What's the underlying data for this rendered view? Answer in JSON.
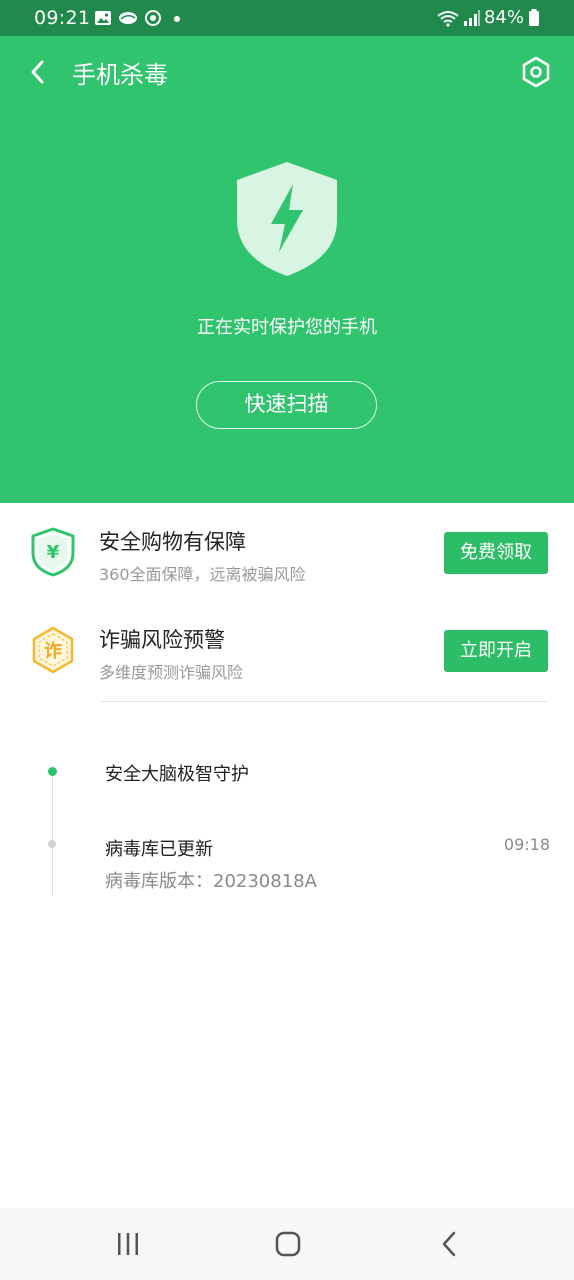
{
  "status_bar": {
    "time": "09:21",
    "battery": "84%"
  },
  "header": {
    "title": "手机杀毒",
    "back_icon": "back-arrow-icon",
    "settings_icon": "settings-hexagon-icon"
  },
  "hero": {
    "status": "正在实时保护您的手机",
    "scan_button": "快速扫描",
    "shield_icon": "lightning-shield-icon"
  },
  "features": [
    {
      "title": "安全购物有保障",
      "subtitle": "360全面保障，远离被骗风险",
      "button": "免费领取",
      "icon": "yuan-shield-icon",
      "icon_text": "¥"
    },
    {
      "title": "诈骗风险预警",
      "subtitle": "多维度预测诈骗风险",
      "button": "立即开启",
      "icon": "fraud-hexagon-icon",
      "icon_text": "诈"
    }
  ],
  "timeline": [
    {
      "title": "安全大脑极智守护"
    },
    {
      "title": "病毒库已更新",
      "time": "09:18",
      "detail": "病毒库版本：20230818A"
    }
  ],
  "colors": {
    "primary": "#30c46f",
    "status_bar": "#1f8a4c",
    "button": "#2dbd66",
    "warning": "#f5b82e"
  }
}
